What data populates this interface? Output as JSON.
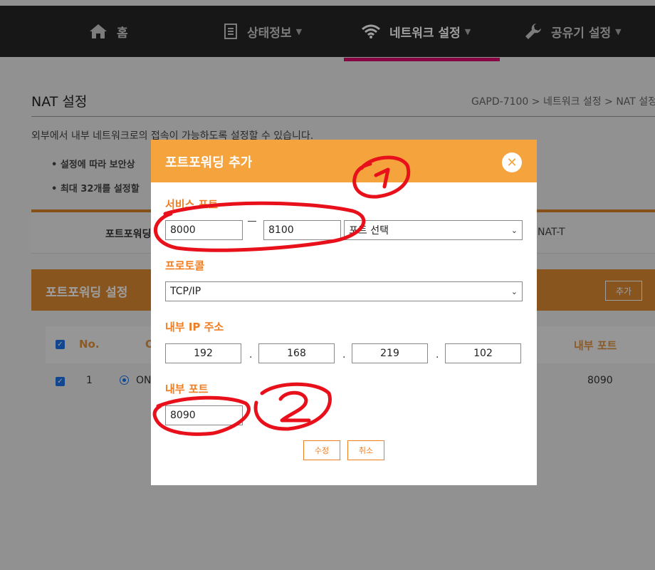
{
  "nav": {
    "home": "홈",
    "status": "상태정보",
    "network": "네트워크 설정",
    "router": "공유기 설정"
  },
  "page": {
    "title": "NAT 설정",
    "breadcrumb": "GAPD-7100 > 네트워크 설정 > NAT 설정",
    "description": "외부에서 내부 네트워크로의 접속이 가능하도록 설정할 수 있습니다.",
    "bullet1": "• 설정에 따라 보안상",
    "bullet2": "• 최대 32개를 설정할",
    "type_label": "포트포워딩",
    "type_natt": "NAT-T",
    "section_title": "포트포워딩 설정",
    "section_add": "추가"
  },
  "table": {
    "headers": {
      "no": "No.",
      "on": "O",
      "internal_port": "내부 포트"
    },
    "row": {
      "no": "1",
      "status": "ON",
      "internal_port": "8090"
    }
  },
  "modal": {
    "title": "포트포워딩 추가",
    "service_port_label": "서비스 포트",
    "service_port_start": "8000",
    "service_port_end": "8100",
    "port_select": "포트 선택",
    "protocol_label": "프로토콜",
    "protocol_value": "TCP/IP",
    "ip_label": "내부 IP 주소",
    "ip": [
      "192",
      "168",
      "219",
      "102"
    ],
    "internal_port_label": "내부 포트",
    "internal_port_value": "8090",
    "edit_button": "수정",
    "cancel_button": "취소"
  },
  "colors": {
    "accent": "#f4a33d",
    "label": "#ef7d22",
    "nav_bg": "#262626",
    "nav_active": "#d8066f",
    "annotation": "#e8101a"
  }
}
